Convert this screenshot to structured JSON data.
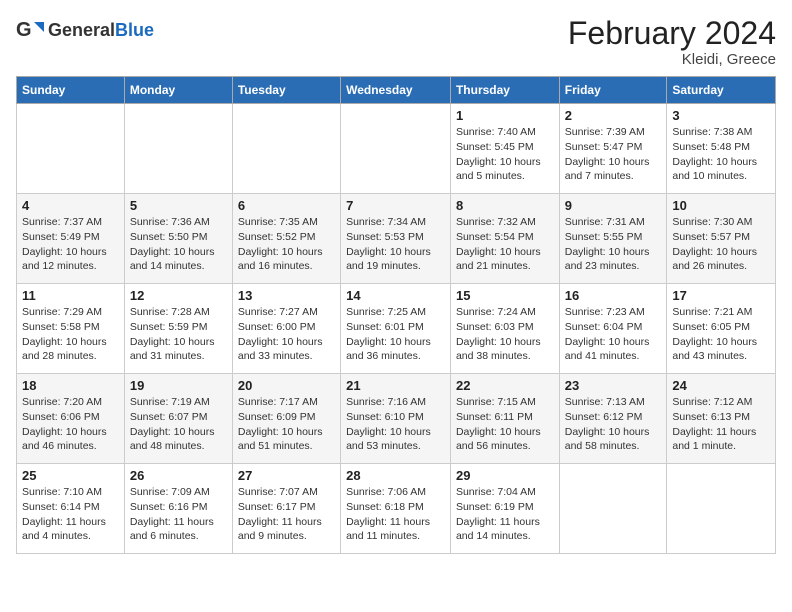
{
  "header": {
    "logo_general": "General",
    "logo_blue": "Blue",
    "month_title": "February 2024",
    "location": "Kleidi, Greece"
  },
  "days_of_week": [
    "Sunday",
    "Monday",
    "Tuesday",
    "Wednesday",
    "Thursday",
    "Friday",
    "Saturday"
  ],
  "weeks": [
    [
      {
        "day": "",
        "info": ""
      },
      {
        "day": "",
        "info": ""
      },
      {
        "day": "",
        "info": ""
      },
      {
        "day": "",
        "info": ""
      },
      {
        "day": "1",
        "info": "Sunrise: 7:40 AM\nSunset: 5:45 PM\nDaylight: 10 hours\nand 5 minutes."
      },
      {
        "day": "2",
        "info": "Sunrise: 7:39 AM\nSunset: 5:47 PM\nDaylight: 10 hours\nand 7 minutes."
      },
      {
        "day": "3",
        "info": "Sunrise: 7:38 AM\nSunset: 5:48 PM\nDaylight: 10 hours\nand 10 minutes."
      }
    ],
    [
      {
        "day": "4",
        "info": "Sunrise: 7:37 AM\nSunset: 5:49 PM\nDaylight: 10 hours\nand 12 minutes."
      },
      {
        "day": "5",
        "info": "Sunrise: 7:36 AM\nSunset: 5:50 PM\nDaylight: 10 hours\nand 14 minutes."
      },
      {
        "day": "6",
        "info": "Sunrise: 7:35 AM\nSunset: 5:52 PM\nDaylight: 10 hours\nand 16 minutes."
      },
      {
        "day": "7",
        "info": "Sunrise: 7:34 AM\nSunset: 5:53 PM\nDaylight: 10 hours\nand 19 minutes."
      },
      {
        "day": "8",
        "info": "Sunrise: 7:32 AM\nSunset: 5:54 PM\nDaylight: 10 hours\nand 21 minutes."
      },
      {
        "day": "9",
        "info": "Sunrise: 7:31 AM\nSunset: 5:55 PM\nDaylight: 10 hours\nand 23 minutes."
      },
      {
        "day": "10",
        "info": "Sunrise: 7:30 AM\nSunset: 5:57 PM\nDaylight: 10 hours\nand 26 minutes."
      }
    ],
    [
      {
        "day": "11",
        "info": "Sunrise: 7:29 AM\nSunset: 5:58 PM\nDaylight: 10 hours\nand 28 minutes."
      },
      {
        "day": "12",
        "info": "Sunrise: 7:28 AM\nSunset: 5:59 PM\nDaylight: 10 hours\nand 31 minutes."
      },
      {
        "day": "13",
        "info": "Sunrise: 7:27 AM\nSunset: 6:00 PM\nDaylight: 10 hours\nand 33 minutes."
      },
      {
        "day": "14",
        "info": "Sunrise: 7:25 AM\nSunset: 6:01 PM\nDaylight: 10 hours\nand 36 minutes."
      },
      {
        "day": "15",
        "info": "Sunrise: 7:24 AM\nSunset: 6:03 PM\nDaylight: 10 hours\nand 38 minutes."
      },
      {
        "day": "16",
        "info": "Sunrise: 7:23 AM\nSunset: 6:04 PM\nDaylight: 10 hours\nand 41 minutes."
      },
      {
        "day": "17",
        "info": "Sunrise: 7:21 AM\nSunset: 6:05 PM\nDaylight: 10 hours\nand 43 minutes."
      }
    ],
    [
      {
        "day": "18",
        "info": "Sunrise: 7:20 AM\nSunset: 6:06 PM\nDaylight: 10 hours\nand 46 minutes."
      },
      {
        "day": "19",
        "info": "Sunrise: 7:19 AM\nSunset: 6:07 PM\nDaylight: 10 hours\nand 48 minutes."
      },
      {
        "day": "20",
        "info": "Sunrise: 7:17 AM\nSunset: 6:09 PM\nDaylight: 10 hours\nand 51 minutes."
      },
      {
        "day": "21",
        "info": "Sunrise: 7:16 AM\nSunset: 6:10 PM\nDaylight: 10 hours\nand 53 minutes."
      },
      {
        "day": "22",
        "info": "Sunrise: 7:15 AM\nSunset: 6:11 PM\nDaylight: 10 hours\nand 56 minutes."
      },
      {
        "day": "23",
        "info": "Sunrise: 7:13 AM\nSunset: 6:12 PM\nDaylight: 10 hours\nand 58 minutes."
      },
      {
        "day": "24",
        "info": "Sunrise: 7:12 AM\nSunset: 6:13 PM\nDaylight: 11 hours\nand 1 minute."
      }
    ],
    [
      {
        "day": "25",
        "info": "Sunrise: 7:10 AM\nSunset: 6:14 PM\nDaylight: 11 hours\nand 4 minutes."
      },
      {
        "day": "26",
        "info": "Sunrise: 7:09 AM\nSunset: 6:16 PM\nDaylight: 11 hours\nand 6 minutes."
      },
      {
        "day": "27",
        "info": "Sunrise: 7:07 AM\nSunset: 6:17 PM\nDaylight: 11 hours\nand 9 minutes."
      },
      {
        "day": "28",
        "info": "Sunrise: 7:06 AM\nSunset: 6:18 PM\nDaylight: 11 hours\nand 11 minutes."
      },
      {
        "day": "29",
        "info": "Sunrise: 7:04 AM\nSunset: 6:19 PM\nDaylight: 11 hours\nand 14 minutes."
      },
      {
        "day": "",
        "info": ""
      },
      {
        "day": "",
        "info": ""
      }
    ]
  ]
}
